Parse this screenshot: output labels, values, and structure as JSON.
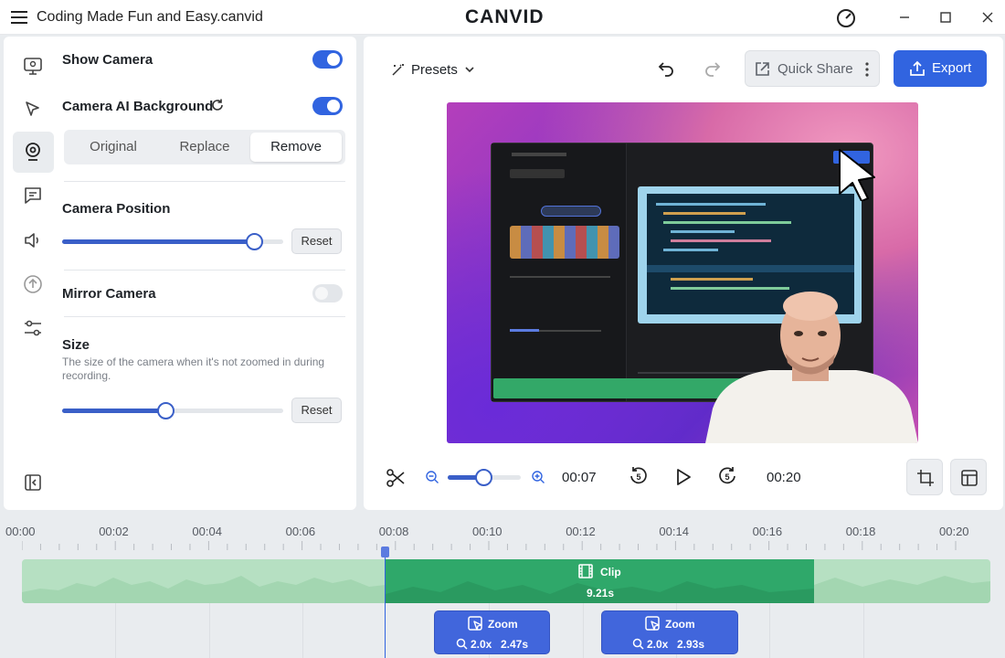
{
  "titlebar": {
    "document": "Coding Made Fun and Easy.canvid",
    "logo": "CANVID"
  },
  "camera_panel": {
    "show_camera": {
      "label": "Show Camera",
      "on": true
    },
    "ai_background": {
      "label": "Camera AI Background",
      "on": true
    },
    "background_modes": [
      "Original",
      "Replace",
      "Remove"
    ],
    "selected_mode": "Remove",
    "position": {
      "label": "Camera Position",
      "value": 0.87,
      "reset": "Reset"
    },
    "mirror": {
      "label": "Mirror Camera",
      "on": false
    },
    "size": {
      "label": "Size",
      "description": "The size of the camera when it's not zoomed in during recording.",
      "value": 0.47,
      "reset": "Reset"
    }
  },
  "editor": {
    "presets_label": "Presets",
    "quick_share_label": "Quick Share",
    "export_label": "Export",
    "current_time": "00:07",
    "end_time": "00:20",
    "zoom_level": 0.5,
    "skip_seconds": "5"
  },
  "timeline": {
    "ticks": [
      "00:00",
      "00:02",
      "00:04",
      "00:06",
      "00:08",
      "00:10",
      "00:12",
      "00:14",
      "00:16",
      "00:18",
      "00:20"
    ],
    "clip": {
      "label": "Clip",
      "duration": "9.21s"
    },
    "zooms": [
      {
        "label": "Zoom",
        "factor": "2.0x",
        "duration": "2.47s"
      },
      {
        "label": "Zoom",
        "factor": "2.0x",
        "duration": "2.93s"
      }
    ]
  },
  "colors": {
    "accent": "#3164e0",
    "clip": "#2fa86a",
    "clip_light": "#b6e0c2",
    "zoom": "#4166dc"
  }
}
